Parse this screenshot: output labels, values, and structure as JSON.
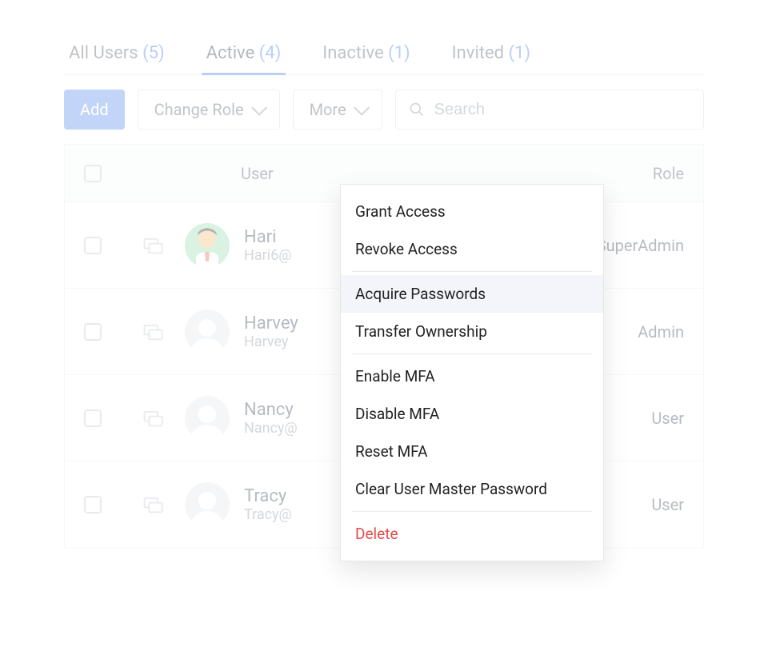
{
  "tabs": [
    {
      "label": "All Users",
      "count": "(5)",
      "active": false
    },
    {
      "label": "Active",
      "count": "(4)",
      "active": true
    },
    {
      "label": "Inactive",
      "count": "(1)",
      "active": false
    },
    {
      "label": "Invited",
      "count": "(1)",
      "active": false
    }
  ],
  "toolbar": {
    "add": "Add",
    "change_role": "Change Role",
    "more": "More",
    "search_placeholder": "Search"
  },
  "table": {
    "headers": {
      "user": "User",
      "role": "Role"
    },
    "rows": [
      {
        "name": "Hari",
        "email": "Hari6@",
        "role": "SuperAdmin",
        "avatar": "hari"
      },
      {
        "name": "Harvey",
        "email": "Harvey",
        "role": "Admin",
        "avatar": "blank"
      },
      {
        "name": "Nancy",
        "email": "Nancy@",
        "role": "User",
        "avatar": "blank"
      },
      {
        "name": "Tracy",
        "email": "Tracy@",
        "role": "User",
        "avatar": "blank"
      }
    ]
  },
  "dropdown": {
    "items": [
      {
        "label": "Grant Access",
        "type": "normal"
      },
      {
        "label": "Revoke Access",
        "type": "normal"
      },
      {
        "label": "Acquire Passwords",
        "type": "highlight"
      },
      {
        "label": "Transfer Ownership",
        "type": "normal"
      },
      {
        "label": "Enable MFA",
        "type": "normal"
      },
      {
        "label": "Disable MFA",
        "type": "normal"
      },
      {
        "label": "Reset MFA",
        "type": "normal"
      },
      {
        "label": "Clear User Master Password",
        "type": "normal"
      },
      {
        "label": "Delete",
        "type": "danger"
      }
    ],
    "separators_after": [
      1,
      3,
      7
    ]
  }
}
